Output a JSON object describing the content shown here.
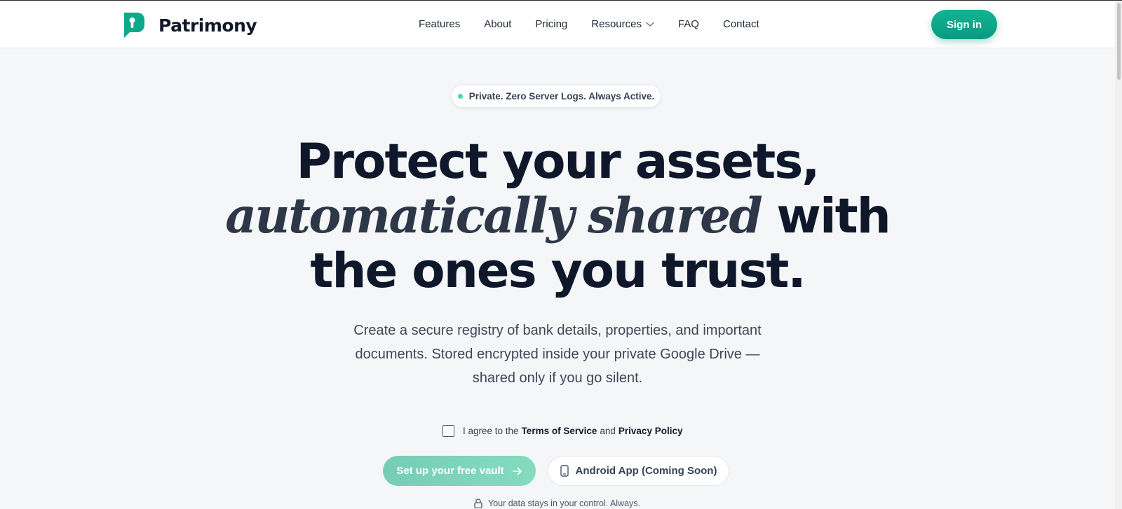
{
  "brand": {
    "name": "Patrimony",
    "accent": "#0ea88a",
    "accent_light": "#7fd6be"
  },
  "nav": {
    "items": [
      {
        "label": "Features"
      },
      {
        "label": "About"
      },
      {
        "label": "Pricing"
      },
      {
        "label": "Resources",
        "dropdown": true
      },
      {
        "label": "FAQ"
      },
      {
        "label": "Contact"
      }
    ],
    "signin_label": "Sign in"
  },
  "hero": {
    "badge": "Private. Zero Server Logs. Always Active.",
    "headline": {
      "line1": "Protect your assets,",
      "line2_italic": "automatically shared",
      "line2_rest": "with",
      "line3": "the ones you trust."
    },
    "subtext": "Create a secure registry of bank details, properties, and important documents. Stored encrypted inside your private Google Drive — shared only if you go silent.",
    "agree": {
      "prefix": "I agree to the",
      "terms": "Terms of Service",
      "and": "and",
      "privacy": "Privacy Policy",
      "checked": false
    },
    "cta_primary": "Set up your free vault",
    "cta_secondary": "Android App (Coming Soon)",
    "footnote": "Your data stays in your control. Always."
  },
  "icons": {
    "logo": "keyhole-bubble-icon",
    "dropdown": "chevron-down-icon",
    "arrow": "arrow-right-icon",
    "phone": "smartphone-icon",
    "lock": "lock-icon"
  }
}
